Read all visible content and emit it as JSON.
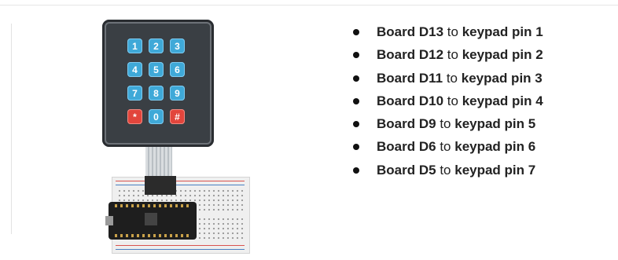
{
  "diagram": {
    "keypad": {
      "keys": [
        "1",
        "2",
        "3",
        "4",
        "5",
        "6",
        "7",
        "8",
        "9",
        "*",
        "0",
        "#"
      ],
      "key_color": "#3fa9d8",
      "special_key_color": "#e2453c",
      "body_color": "#3a3f44"
    },
    "board_color": "#1e1e1e"
  },
  "connections": [
    {
      "board": "Board D13",
      "to": "to",
      "pin": "keypad pin 1"
    },
    {
      "board": "Board D12",
      "to": "to",
      "pin": "keypad pin 2"
    },
    {
      "board": "Board D11",
      "to": "to",
      "pin": "keypad pin 3"
    },
    {
      "board": "Board D10",
      "to": "to",
      "pin": "keypad pin 4"
    },
    {
      "board": "Board D9",
      "to": "to",
      "pin": "keypad pin 5"
    },
    {
      "board": "Board D6",
      "to": "to",
      "pin": "keypad pin 6"
    },
    {
      "board": "Board D5",
      "to": "to",
      "pin": "keypad pin 7"
    }
  ]
}
